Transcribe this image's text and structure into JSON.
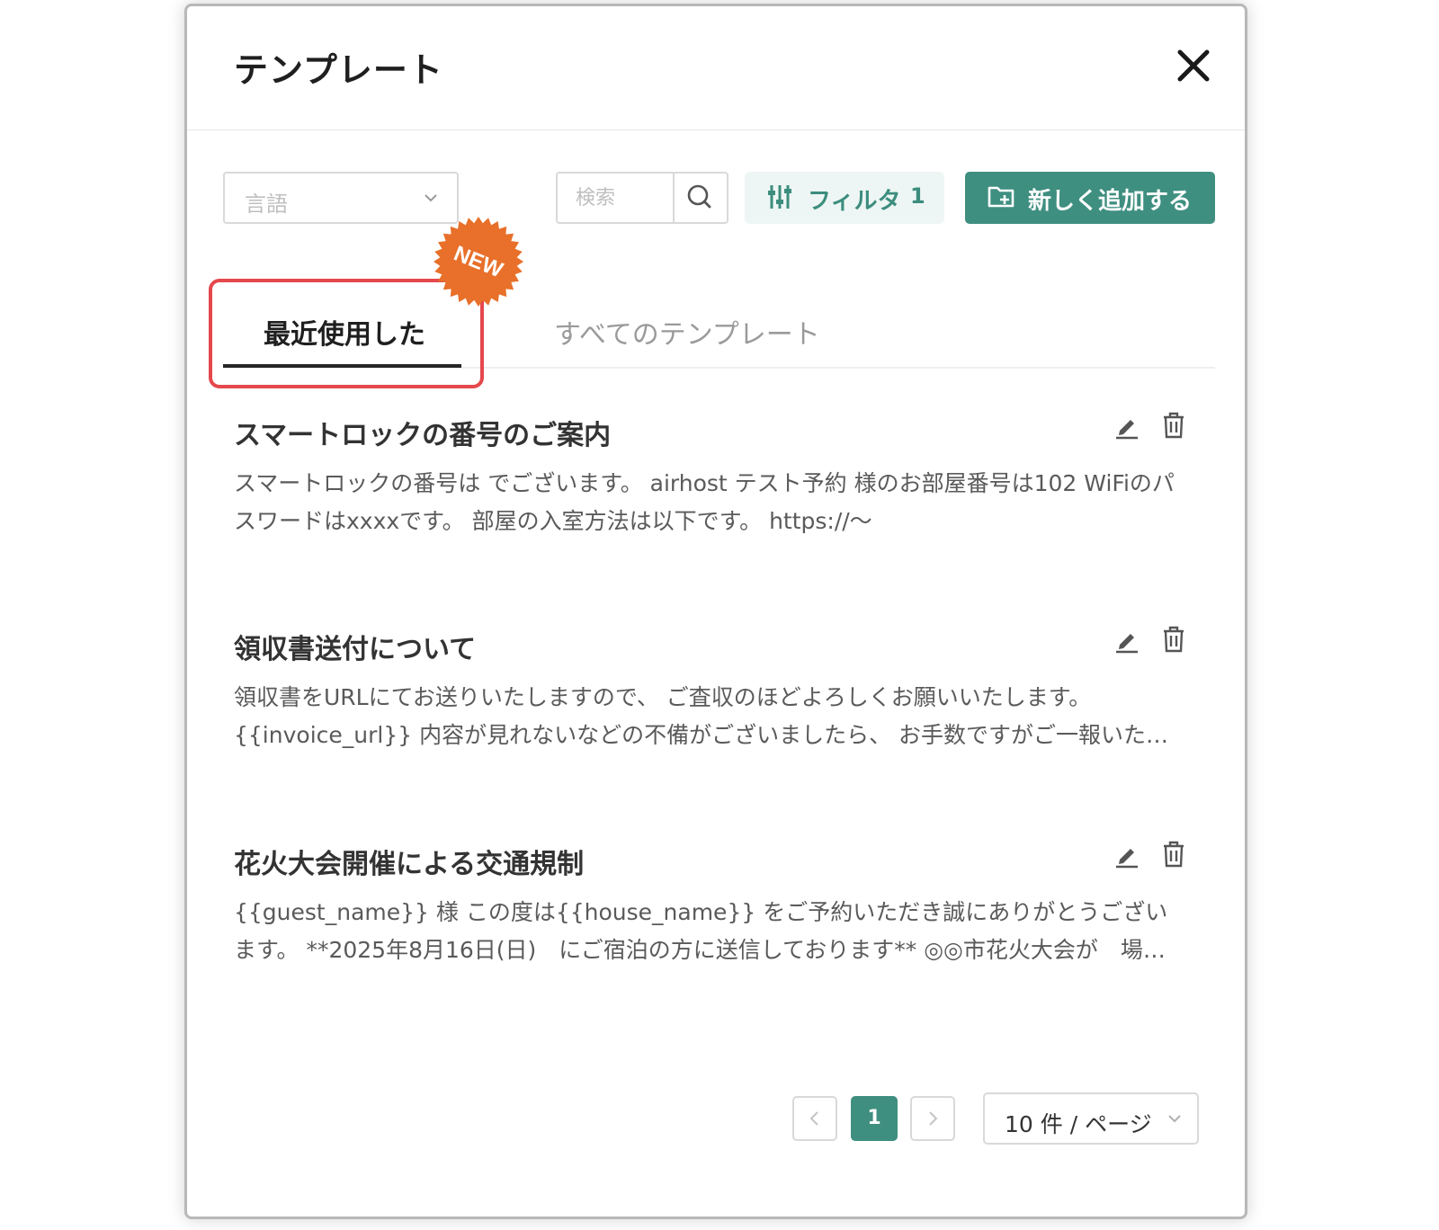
{
  "modal": {
    "title": "テンプレート"
  },
  "toolbar": {
    "language_placeholder": "言語",
    "search_placeholder": "検索",
    "filter_label": "フィルタ",
    "filter_count": "1",
    "add_label": "新しく追加する"
  },
  "tabs": [
    {
      "label": "最近使用した",
      "active": true
    },
    {
      "label": "すべてのテンプレート",
      "active": false
    }
  ],
  "badge": {
    "text": "NEW",
    "color": "#e8702a"
  },
  "templates": [
    {
      "title": "スマートロックの番号のご案内",
      "body": "スマートロックの番号は でございます。 airhost テスト予約 様のお部屋番号は102 WiFiのパスワードはxxxxです。 部屋の入室方法は以下です。 https://〜"
    },
    {
      "title": "領収書送付について",
      "body": "領収書をURLにてお送りいたしますので、 ご査収のほどよろしくお願いいたします。 {{invoice_url}} 内容が見れないなどの不備がございましたら、 お手数ですがご一報いただけますと幸いです。"
    },
    {
      "title": "花火大会開催による交通規制",
      "body": "{{guest_name}} 様 この度は{{house_name}} をご予約いただき誠にありがとうございます。 **2025年8月16日(日)　にご宿泊の方に送信しております** ◎◎市花火大会が　場所：◎◎公園にて開催されます。"
    }
  ],
  "pagination": {
    "current_page": "1",
    "page_size_label": "10 件 / ページ"
  },
  "colors": {
    "primary": "#3f8f80",
    "highlight": "#e5484d",
    "filter_bg": "#edf6f4"
  }
}
